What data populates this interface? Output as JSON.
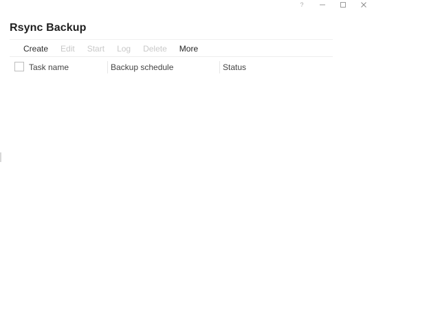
{
  "window_controls": {
    "help": "?",
    "minimize_icon": "minimize-icon",
    "maximize_icon": "maximize-icon",
    "close_icon": "close-icon"
  },
  "app": {
    "title": "Rsync Backup"
  },
  "toolbar": {
    "create": "Create",
    "edit": "Edit",
    "start": "Start",
    "log": "Log",
    "delete": "Delete",
    "more": "More"
  },
  "table": {
    "columns": [
      "Task name",
      "Backup schedule",
      "Status"
    ],
    "rows": []
  },
  "colors": {
    "background": "#ffffff",
    "enabled_text": "#2b2b2b",
    "disabled_text": "#c8c8c8"
  }
}
